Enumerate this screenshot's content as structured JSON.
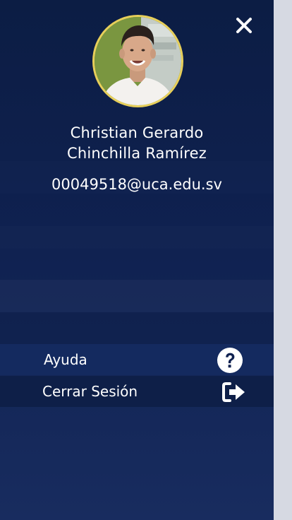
{
  "profile": {
    "name_line1": "Christian Gerardo",
    "name_line2": "Chinchilla Ramírez",
    "email": "00049518@uca.edu.sv"
  },
  "menu": {
    "items": [
      {
        "label": "Ayuda",
        "icon": "question-circle-icon"
      },
      {
        "label": "Cerrar Sesión",
        "icon": "sign-out-icon"
      }
    ]
  },
  "header": {
    "close_icon": "close-icon"
  },
  "colors": {
    "drawer_top": "#0c1d44",
    "drawer_bottom": "#182c5f",
    "avatar_border": "#e7cf5a",
    "text": "#ffffff",
    "scrim": "#d6d9e2"
  }
}
